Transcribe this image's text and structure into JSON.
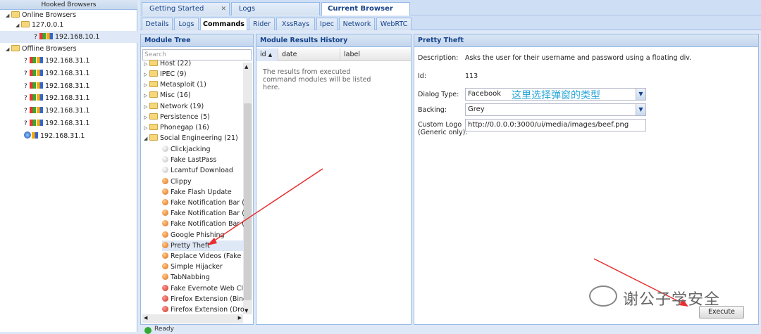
{
  "hooked": {
    "title": "Hooked Browsers",
    "online_label": "Online Browsers",
    "online_host": "127.0.0.1",
    "online_ip": "192.168.10.1",
    "offline_label": "Offline Browsers",
    "offline_ips": [
      "192.168.31.1",
      "192.168.31.1",
      "192.168.31.1",
      "192.168.31.1",
      "192.168.31.1",
      "192.168.31.1",
      "192.168.31.1"
    ],
    "unknown_mark": "?"
  },
  "tabs_top": [
    "Getting Started",
    "Logs",
    "Current Browser"
  ],
  "tabs_sub": [
    "Details",
    "Logs",
    "Commands",
    "Rider",
    "XssRays",
    "Ipec",
    "Network",
    "WebRTC"
  ],
  "module_tree": {
    "title": "Module Tree",
    "search_placeholder": "Search",
    "folders": [
      "Host (22)",
      "IPEC (9)",
      "Metasploit (1)",
      "Misc (16)",
      "Network (19)",
      "Persistence (5)",
      "Phonegap (16)"
    ],
    "open_folder": "Social Engineering (21)",
    "modules": [
      {
        "label": "Clickjacking",
        "status": "grey"
      },
      {
        "label": "Fake LastPass",
        "status": "grey"
      },
      {
        "label": "Lcamtuf Download",
        "status": "grey"
      },
      {
        "label": "Clippy",
        "status": "orange"
      },
      {
        "label": "Fake Flash Update",
        "status": "orange"
      },
      {
        "label": "Fake Notification Bar (Ch",
        "status": "orange"
      },
      {
        "label": "Fake Notification Bar (Fi",
        "status": "orange"
      },
      {
        "label": "Fake Notification Bar (IE",
        "status": "orange"
      },
      {
        "label": "Google Phishing",
        "status": "orange"
      },
      {
        "label": "Pretty Theft",
        "status": "orange"
      },
      {
        "label": "Replace Videos (Fake P",
        "status": "orange"
      },
      {
        "label": "Simple Hijacker",
        "status": "orange"
      },
      {
        "label": "TabNabbing",
        "status": "orange"
      },
      {
        "label": "Fake Evernote Web Clip",
        "status": "red"
      },
      {
        "label": "Firefox Extension (Binds",
        "status": "red"
      },
      {
        "label": "Firefox Extension (Dropp",
        "status": "red"
      }
    ]
  },
  "results": {
    "title": "Module Results History",
    "col_id": "id",
    "col_date": "date",
    "col_label": "label",
    "empty_msg": "The results from executed command modules will be listed here."
  },
  "detail": {
    "title": "Pretty Theft",
    "desc_label": "Description:",
    "desc_value": "Asks the user for their username and password using a floating div.",
    "id_label": "Id:",
    "id_value": "113",
    "dialog_label": "Dialog Type:",
    "dialog_value": "Facebook",
    "dialog_note": "这里选择弹窗的类型",
    "backing_label": "Backing:",
    "backing_value": "Grey",
    "logo_label_1": "Custom Logo",
    "logo_label_2": "(Generic only):",
    "logo_value": "http://0.0.0.0:3000/ui/media/images/beef.png",
    "execute_label": "Execute"
  },
  "status": {
    "text": "Ready"
  },
  "watermark": "谢公子学安全",
  "colors": {
    "header": "#15428b",
    "border": "#99bbe8",
    "arrow": "#e83030",
    "note": "#29a6d8"
  }
}
